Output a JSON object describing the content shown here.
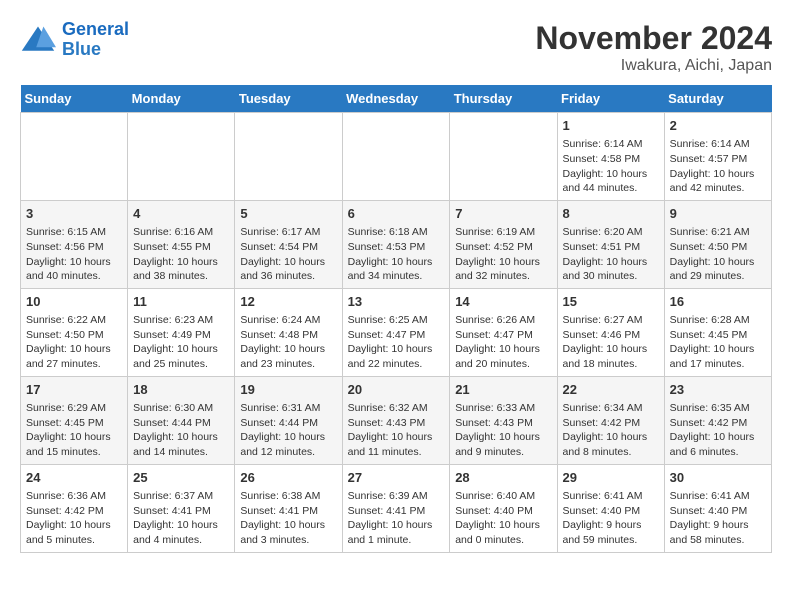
{
  "header": {
    "logo_line1": "General",
    "logo_line2": "Blue",
    "title": "November 2024",
    "subtitle": "Iwakura, Aichi, Japan"
  },
  "days_of_week": [
    "Sunday",
    "Monday",
    "Tuesday",
    "Wednesday",
    "Thursday",
    "Friday",
    "Saturday"
  ],
  "weeks": [
    [
      {
        "day": "",
        "content": ""
      },
      {
        "day": "",
        "content": ""
      },
      {
        "day": "",
        "content": ""
      },
      {
        "day": "",
        "content": ""
      },
      {
        "day": "",
        "content": ""
      },
      {
        "day": "1",
        "content": "Sunrise: 6:14 AM\nSunset: 4:58 PM\nDaylight: 10 hours and 44 minutes."
      },
      {
        "day": "2",
        "content": "Sunrise: 6:14 AM\nSunset: 4:57 PM\nDaylight: 10 hours and 42 minutes."
      }
    ],
    [
      {
        "day": "3",
        "content": "Sunrise: 6:15 AM\nSunset: 4:56 PM\nDaylight: 10 hours and 40 minutes."
      },
      {
        "day": "4",
        "content": "Sunrise: 6:16 AM\nSunset: 4:55 PM\nDaylight: 10 hours and 38 minutes."
      },
      {
        "day": "5",
        "content": "Sunrise: 6:17 AM\nSunset: 4:54 PM\nDaylight: 10 hours and 36 minutes."
      },
      {
        "day": "6",
        "content": "Sunrise: 6:18 AM\nSunset: 4:53 PM\nDaylight: 10 hours and 34 minutes."
      },
      {
        "day": "7",
        "content": "Sunrise: 6:19 AM\nSunset: 4:52 PM\nDaylight: 10 hours and 32 minutes."
      },
      {
        "day": "8",
        "content": "Sunrise: 6:20 AM\nSunset: 4:51 PM\nDaylight: 10 hours and 30 minutes."
      },
      {
        "day": "9",
        "content": "Sunrise: 6:21 AM\nSunset: 4:50 PM\nDaylight: 10 hours and 29 minutes."
      }
    ],
    [
      {
        "day": "10",
        "content": "Sunrise: 6:22 AM\nSunset: 4:50 PM\nDaylight: 10 hours and 27 minutes."
      },
      {
        "day": "11",
        "content": "Sunrise: 6:23 AM\nSunset: 4:49 PM\nDaylight: 10 hours and 25 minutes."
      },
      {
        "day": "12",
        "content": "Sunrise: 6:24 AM\nSunset: 4:48 PM\nDaylight: 10 hours and 23 minutes."
      },
      {
        "day": "13",
        "content": "Sunrise: 6:25 AM\nSunset: 4:47 PM\nDaylight: 10 hours and 22 minutes."
      },
      {
        "day": "14",
        "content": "Sunrise: 6:26 AM\nSunset: 4:47 PM\nDaylight: 10 hours and 20 minutes."
      },
      {
        "day": "15",
        "content": "Sunrise: 6:27 AM\nSunset: 4:46 PM\nDaylight: 10 hours and 18 minutes."
      },
      {
        "day": "16",
        "content": "Sunrise: 6:28 AM\nSunset: 4:45 PM\nDaylight: 10 hours and 17 minutes."
      }
    ],
    [
      {
        "day": "17",
        "content": "Sunrise: 6:29 AM\nSunset: 4:45 PM\nDaylight: 10 hours and 15 minutes."
      },
      {
        "day": "18",
        "content": "Sunrise: 6:30 AM\nSunset: 4:44 PM\nDaylight: 10 hours and 14 minutes."
      },
      {
        "day": "19",
        "content": "Sunrise: 6:31 AM\nSunset: 4:44 PM\nDaylight: 10 hours and 12 minutes."
      },
      {
        "day": "20",
        "content": "Sunrise: 6:32 AM\nSunset: 4:43 PM\nDaylight: 10 hours and 11 minutes."
      },
      {
        "day": "21",
        "content": "Sunrise: 6:33 AM\nSunset: 4:43 PM\nDaylight: 10 hours and 9 minutes."
      },
      {
        "day": "22",
        "content": "Sunrise: 6:34 AM\nSunset: 4:42 PM\nDaylight: 10 hours and 8 minutes."
      },
      {
        "day": "23",
        "content": "Sunrise: 6:35 AM\nSunset: 4:42 PM\nDaylight: 10 hours and 6 minutes."
      }
    ],
    [
      {
        "day": "24",
        "content": "Sunrise: 6:36 AM\nSunset: 4:42 PM\nDaylight: 10 hours and 5 minutes."
      },
      {
        "day": "25",
        "content": "Sunrise: 6:37 AM\nSunset: 4:41 PM\nDaylight: 10 hours and 4 minutes."
      },
      {
        "day": "26",
        "content": "Sunrise: 6:38 AM\nSunset: 4:41 PM\nDaylight: 10 hours and 3 minutes."
      },
      {
        "day": "27",
        "content": "Sunrise: 6:39 AM\nSunset: 4:41 PM\nDaylight: 10 hours and 1 minute."
      },
      {
        "day": "28",
        "content": "Sunrise: 6:40 AM\nSunset: 4:40 PM\nDaylight: 10 hours and 0 minutes."
      },
      {
        "day": "29",
        "content": "Sunrise: 6:41 AM\nSunset: 4:40 PM\nDaylight: 9 hours and 59 minutes."
      },
      {
        "day": "30",
        "content": "Sunrise: 6:41 AM\nSunset: 4:40 PM\nDaylight: 9 hours and 58 minutes."
      }
    ]
  ]
}
